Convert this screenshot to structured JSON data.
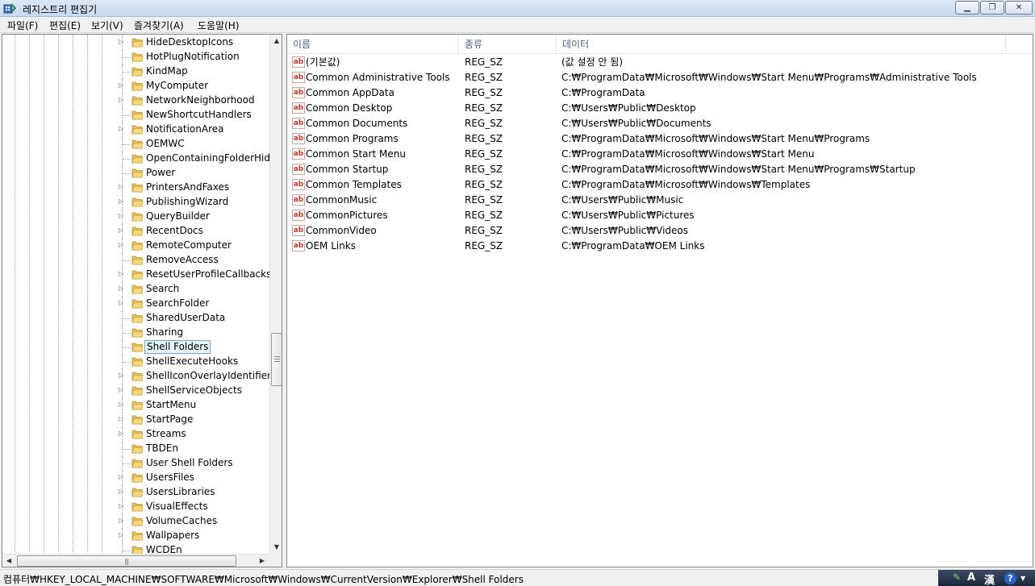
{
  "window": {
    "title": "레지스트리 편집기",
    "min_symbol": "▁",
    "max_symbol": "❐",
    "close_symbol": "✕"
  },
  "menu": [
    "파일(F)",
    "편집(E)",
    "보기(V)",
    "즐겨찾기(A)",
    "도움말(H)"
  ],
  "tree": {
    "items": [
      {
        "label": "HideDesktopIcons",
        "expandable": true
      },
      {
        "label": "HotPlugNotification",
        "expandable": false
      },
      {
        "label": "KindMap",
        "expandable": false
      },
      {
        "label": "MyComputer",
        "expandable": true
      },
      {
        "label": "NetworkNeighborhood",
        "expandable": true
      },
      {
        "label": "NewShortcutHandlers",
        "expandable": false
      },
      {
        "label": "NotificationArea",
        "expandable": true
      },
      {
        "label": "OEMWC",
        "expandable": false
      },
      {
        "label": "OpenContainingFolderHidde",
        "expandable": false
      },
      {
        "label": "Power",
        "expandable": false
      },
      {
        "label": "PrintersAndFaxes",
        "expandable": true
      },
      {
        "label": "PublishingWizard",
        "expandable": true
      },
      {
        "label": "QueryBuilder",
        "expandable": true
      },
      {
        "label": "RecentDocs",
        "expandable": true
      },
      {
        "label": "RemoteComputer",
        "expandable": true
      },
      {
        "label": "RemoveAccess",
        "expandable": false
      },
      {
        "label": "ResetUserProfileCallbacks",
        "expandable": true
      },
      {
        "label": "Search",
        "expandable": true
      },
      {
        "label": "SearchFolder",
        "expandable": true
      },
      {
        "label": "SharedUserData",
        "expandable": false
      },
      {
        "label": "Sharing",
        "expandable": false
      },
      {
        "label": "Shell Folders",
        "expandable": false,
        "selected": true
      },
      {
        "label": "ShellExecuteHooks",
        "expandable": false
      },
      {
        "label": "ShellIconOverlayIdentifiers",
        "expandable": true
      },
      {
        "label": "ShellServiceObjects",
        "expandable": true
      },
      {
        "label": "StartMenu",
        "expandable": true
      },
      {
        "label": "StartPage",
        "expandable": true
      },
      {
        "label": "Streams",
        "expandable": true
      },
      {
        "label": "TBDEn",
        "expandable": false
      },
      {
        "label": "User Shell Folders",
        "expandable": false
      },
      {
        "label": "UsersFiles",
        "expandable": true
      },
      {
        "label": "UsersLibraries",
        "expandable": true
      },
      {
        "label": "VisualEffects",
        "expandable": true
      },
      {
        "label": "VolumeCaches",
        "expandable": true
      },
      {
        "label": "Wallpapers",
        "expandable": true
      },
      {
        "label": "WCDEn",
        "expandable": false
      }
    ],
    "scroll_up": "▲",
    "scroll_down": "▼",
    "scroll_left": "◀",
    "scroll_right": "▶",
    "hgrip": "|||"
  },
  "list": {
    "columns": {
      "name": "이름",
      "type": "종류",
      "data": "데이터"
    },
    "icon_text": "ab",
    "rows": [
      {
        "name": "(기본값)",
        "type": "REG_SZ",
        "data": "(값 설정 안 됨)"
      },
      {
        "name": "Common Administrative Tools",
        "type": "REG_SZ",
        "data": "C:₩ProgramData₩Microsoft₩Windows₩Start Menu₩Programs₩Administrative Tools"
      },
      {
        "name": "Common AppData",
        "type": "REG_SZ",
        "data": "C:₩ProgramData"
      },
      {
        "name": "Common Desktop",
        "type": "REG_SZ",
        "data": "C:₩Users₩Public₩Desktop"
      },
      {
        "name": "Common Documents",
        "type": "REG_SZ",
        "data": "C:₩Users₩Public₩Documents"
      },
      {
        "name": "Common Programs",
        "type": "REG_SZ",
        "data": "C:₩ProgramData₩Microsoft₩Windows₩Start Menu₩Programs"
      },
      {
        "name": "Common Start Menu",
        "type": "REG_SZ",
        "data": "C:₩ProgramData₩Microsoft₩Windows₩Start Menu"
      },
      {
        "name": "Common Startup",
        "type": "REG_SZ",
        "data": "C:₩ProgramData₩Microsoft₩Windows₩Start Menu₩Programs₩Startup"
      },
      {
        "name": "Common Templates",
        "type": "REG_SZ",
        "data": "C:₩ProgramData₩Microsoft₩Windows₩Templates"
      },
      {
        "name": "CommonMusic",
        "type": "REG_SZ",
        "data": "C:₩Users₩Public₩Music"
      },
      {
        "name": "CommonPictures",
        "type": "REG_SZ",
        "data": "C:₩Users₩Public₩Pictures"
      },
      {
        "name": "CommonVideo",
        "type": "REG_SZ",
        "data": "C:₩Users₩Public₩Videos"
      },
      {
        "name": "OEM Links",
        "type": "REG_SZ",
        "data": "C:₩ProgramData₩OEM Links"
      }
    ]
  },
  "status": {
    "path": "컴퓨터₩HKEY_LOCAL_MACHINE₩SOFTWARE₩Microsoft₩Windows₩CurrentVersion₩Explorer₩Shell Folders"
  },
  "tray": {
    "ime_tool": "✎",
    "ime_mode": "A",
    "hanja": "漢",
    "help": "?",
    "options": "▼"
  },
  "colors": {
    "selection_bg": "#e5f3fb",
    "selection_border": "#7da2ce",
    "header_text": "#4c607a",
    "folder": "#e8c15a",
    "reg_icon_text": "#c0392b"
  }
}
